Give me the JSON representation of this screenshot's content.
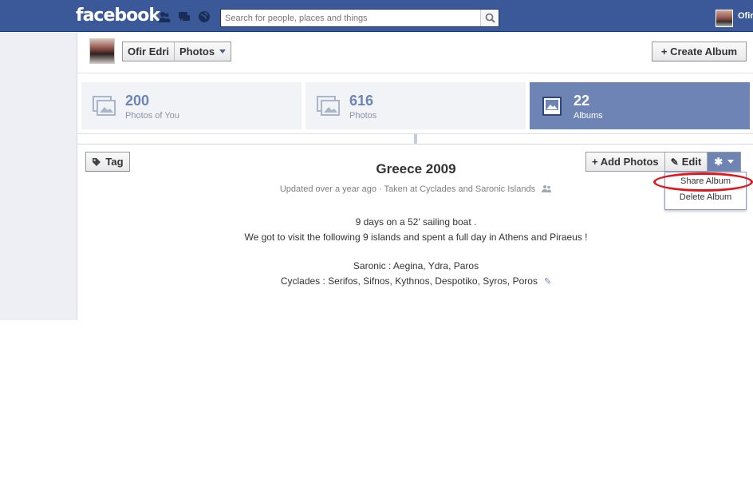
{
  "topbar": {
    "logo": "facebook",
    "search_placeholder": "Search for people, places and things",
    "user_short": "Ofir"
  },
  "header": {
    "name": "Ofir Edri",
    "section": "Photos",
    "create_album": "+ Create Album"
  },
  "stats": [
    {
      "count": "200",
      "label": "Photos of You",
      "selected": false
    },
    {
      "count": "616",
      "label": "Photos",
      "selected": false
    },
    {
      "count": "22",
      "label": "Albums",
      "selected": true
    }
  ],
  "album": {
    "tag_label": "Tag",
    "title": "Greece 2009",
    "meta": "Updated over a year ago · Taken at Cyclades and Saronic Islands",
    "desc_line1": "9 days on a 52' sailing boat .",
    "desc_line2": "We got to visit the following 9 islands and spent a full day in Athens and Piraeus !",
    "desc_line3": "Saronic : Aegina, Ydra, Paros",
    "desc_line4": "Cyclades : Serifos, Sifnos, Kythnos, Despotiko, Syros, Poros",
    "add_photos": "+ Add Photos",
    "edit": "Edit"
  },
  "menu": {
    "share": "Share Album",
    "delete": "Delete Album"
  },
  "colors": {
    "brand_blue": "#3b5998",
    "tile_selected": "#6d84b4",
    "annotation_red": "#e0161c"
  }
}
